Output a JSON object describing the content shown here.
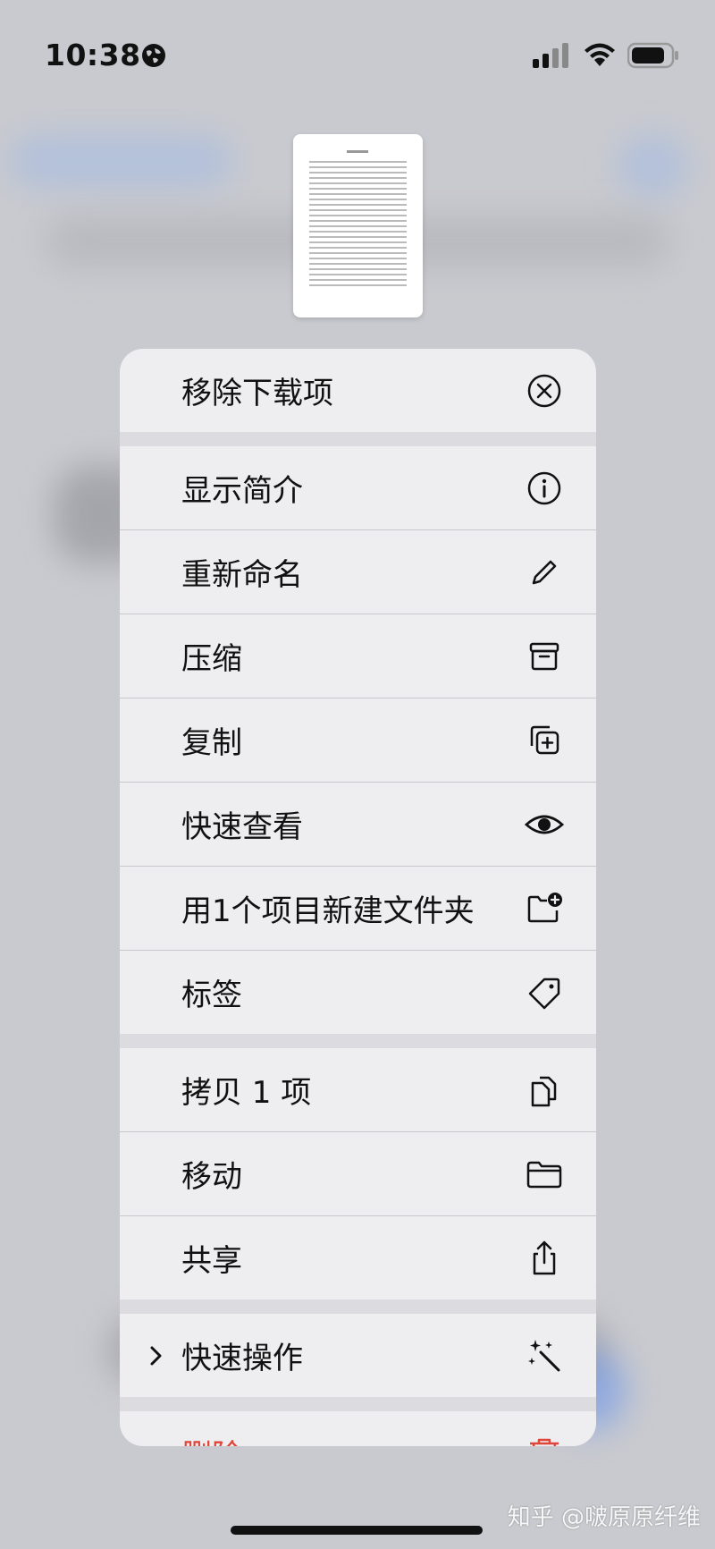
{
  "status": {
    "time": "10:38"
  },
  "menu": {
    "groups": [
      [
        {
          "label": "移除下载项",
          "icon": "remove-circle-icon"
        }
      ],
      [
        {
          "label": "显示简介",
          "icon": "info-circle-icon"
        },
        {
          "label": "重新命名",
          "icon": "pencil-icon"
        },
        {
          "label": "压缩",
          "icon": "archive-box-icon"
        },
        {
          "label": "复制",
          "icon": "duplicate-icon"
        },
        {
          "label": "快速查看",
          "icon": "eye-icon"
        },
        {
          "label": "用1个项目新建文件夹",
          "icon": "folder-badge-plus-icon"
        },
        {
          "label": "标签",
          "icon": "tag-icon"
        }
      ],
      [
        {
          "label": "拷贝 1 项",
          "icon": "copy-documents-icon"
        },
        {
          "label": "移动",
          "icon": "folder-icon"
        },
        {
          "label": "共享",
          "icon": "share-icon"
        }
      ],
      [
        {
          "label": "快速操作",
          "icon": "magic-wand-icon"
        }
      ],
      [
        {
          "label": "删除",
          "icon": "trash-icon"
        }
      ]
    ]
  },
  "watermark": "知乎 @啵原原纤维"
}
